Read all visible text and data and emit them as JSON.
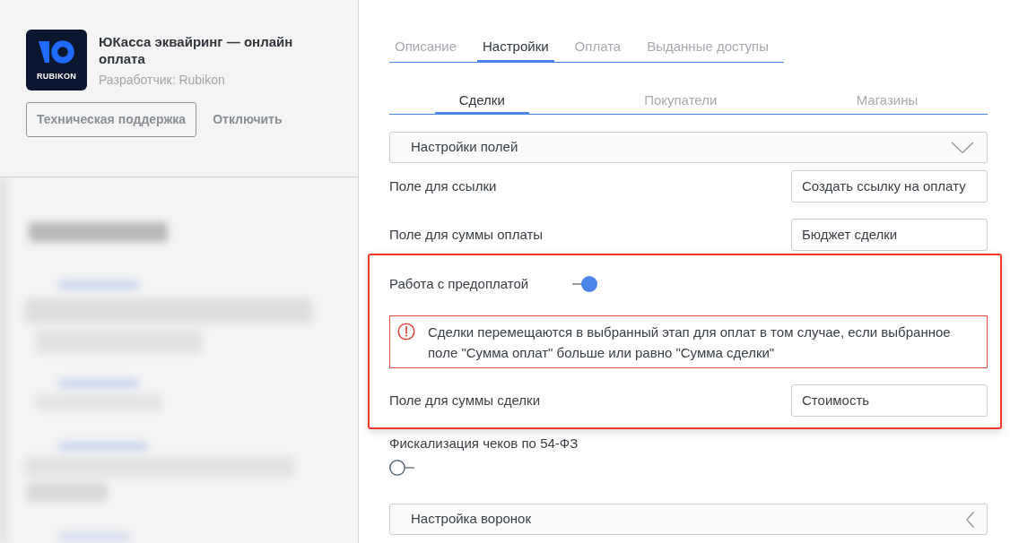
{
  "app": {
    "logo_text": "RUBIKON",
    "title": "ЮКасса эквайринг — онлайн оплата",
    "developer": "Разработчик: Rubikon"
  },
  "actions": [
    {
      "label": "Техническая поддержка",
      "kind": "outlined"
    },
    {
      "label": "Отключить",
      "kind": "plain"
    }
  ],
  "tabs": [
    {
      "label": "Описание",
      "selected": false
    },
    {
      "label": "Настройки",
      "selected": true
    },
    {
      "label": "Оплата",
      "selected": false
    },
    {
      "label": "Выданные доступы",
      "selected": false
    }
  ],
  "subtabs": [
    {
      "label": "Сделки",
      "selected": true
    },
    {
      "label": "Покупатели",
      "selected": false
    },
    {
      "label": "Магазины",
      "selected": false
    }
  ],
  "settings": [
    {
      "kind": "accordion",
      "label": "Настройки полей",
      "expanded": true
    },
    {
      "kind": "select",
      "label": "Поле для ссылки",
      "value": "Создать ссылку на оплату"
    },
    {
      "kind": "select",
      "label": "Поле для суммы оплаты",
      "value": "Бюджет сделки"
    },
    {
      "kind": "group",
      "highlighted": true,
      "items": [
        {
          "kind": "toggle",
          "label": "Работа с предоплатой",
          "on": true
        },
        {
          "kind": "warning",
          "text": "Сделки перемещаются в выбранный этап для оплат в том случае, если выбранное поле \"Сумма оплат\" больше или равно \"Сумма сделки\""
        },
        {
          "kind": "select",
          "label": "Поле для суммы сделки",
          "value": "Стоимость"
        }
      ]
    },
    {
      "kind": "toggle_stacked",
      "label": "Фискализация чеков по 54-ФЗ",
      "on": false
    },
    {
      "kind": "accordion",
      "label": "Настройка воронок",
      "expanded": false
    }
  ]
}
